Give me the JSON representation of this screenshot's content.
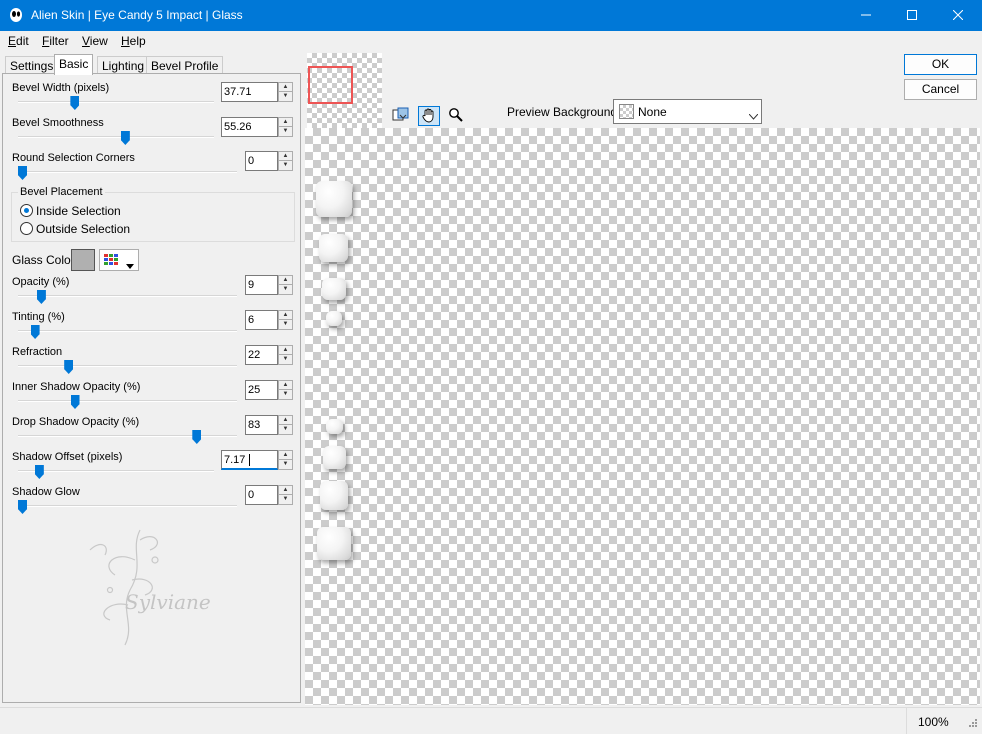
{
  "window": {
    "title": "Alien Skin | Eye Candy 5 Impact | Glass"
  },
  "menu": [
    {
      "accel": "E",
      "rest": "dit"
    },
    {
      "accel": "F",
      "rest": "ilter"
    },
    {
      "accel": "V",
      "rest": "iew"
    },
    {
      "accel": "H",
      "rest": "elp"
    }
  ],
  "tabs": [
    "Settings",
    "Basic",
    "Lighting",
    "Bevel Profile"
  ],
  "controls": {
    "bevel_width": {
      "label": "Bevel Width (pixels)",
      "value": "37.71",
      "fraction": 0.28
    },
    "bevel_smoothness": {
      "label": "Bevel Smoothness",
      "value": "55.26",
      "fraction": 0.55
    },
    "round_corners": {
      "label": "Round Selection Corners",
      "value": "0",
      "fraction": 0.0
    },
    "opacity": {
      "label": "Opacity (%)",
      "value": "9",
      "fraction": 0.09
    },
    "tinting": {
      "label": "Tinting (%)",
      "value": "6",
      "fraction": 0.06
    },
    "refraction": {
      "label": "Refraction",
      "value": "22",
      "fraction": 0.22
    },
    "inner_shadow": {
      "label": "Inner Shadow Opacity (%)",
      "value": "25",
      "fraction": 0.25
    },
    "drop_shadow": {
      "label": "Drop Shadow Opacity (%)",
      "value": "83",
      "fraction": 0.83
    },
    "shadow_offset": {
      "label": "Shadow Offset (pixels)",
      "value": "7.17",
      "fraction": 0.09
    },
    "shadow_glow": {
      "label": "Shadow Glow",
      "value": "0",
      "fraction": 0.0
    }
  },
  "bevel_placement": {
    "title": "Bevel Placement",
    "inside": "Inside Selection",
    "outside": "Outside Selection",
    "selected": "inside"
  },
  "glass_color": {
    "label": "Glass Color",
    "color": "#b0b0b0"
  },
  "preview": {
    "label": "Preview Background:",
    "value": "None"
  },
  "buttons": {
    "ok": "OK",
    "cancel": "Cancel"
  },
  "status": {
    "zoom": "100%"
  },
  "watermark": "Sylviane",
  "colors": {
    "accent": "#0078d7",
    "titlebar": "#0078d7"
  }
}
